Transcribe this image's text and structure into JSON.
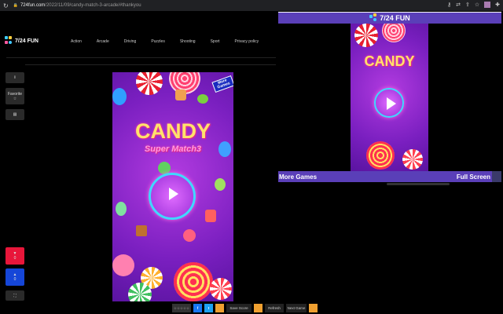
{
  "browser": {
    "url_domain": "724fun.com",
    "url_path": "/2022/11/09/candy-match-3-arcade/#thankyou"
  },
  "site": {
    "logo": "7/24 FUN",
    "nav": [
      "Action",
      "Arcade",
      "Driving",
      "Puzzles",
      "Shooting",
      "Sport",
      "Privacy policy"
    ]
  },
  "sidebar": {
    "info": "i",
    "favorite_label": "Favorite",
    "favorite_icon": "☆",
    "comment": "▤",
    "dislike_count": "0",
    "like_count": "0",
    "fullscreen": "⛶"
  },
  "game": {
    "title": "CANDY",
    "subtitle": "Super Match3",
    "badge": "More Games"
  },
  "bottom": {
    "stars": "☆☆☆☆☆",
    "facebook": "f",
    "twitter": "t",
    "save": "Save Score",
    "refresh": "Refresh",
    "next": "Next Game"
  },
  "panel": {
    "title": "7/24 FUN",
    "more": "More Games",
    "fullscreen": "Full Screen"
  }
}
